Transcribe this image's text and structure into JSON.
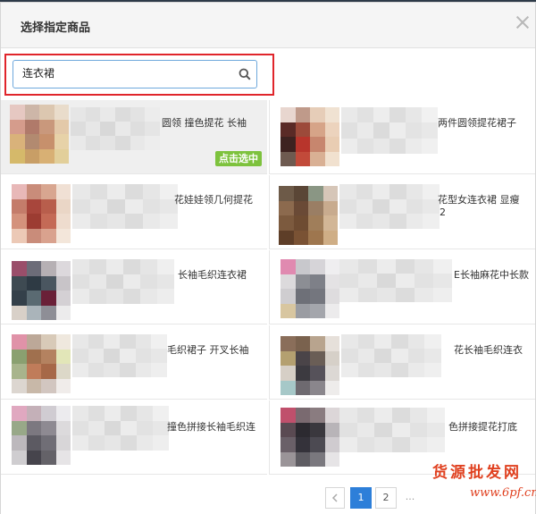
{
  "dialog": {
    "title": "选择指定商品",
    "close_icon": "close-icon"
  },
  "search": {
    "value": "连衣裙",
    "icon": "search-icon"
  },
  "products": [
    {
      "name": "圆领 撞色提花 长袖",
      "selected": true,
      "action_label": "点击选中"
    },
    {
      "name": "两件圆领提花裙子",
      "selected": false
    },
    {
      "name": "花娃娃领几何提花",
      "selected": false
    },
    {
      "name": "花型女连衣裙 显瘦",
      "name_line2": "2",
      "selected": false
    },
    {
      "name": "长袖毛织连衣裙",
      "selected": false
    },
    {
      "name": "E长袖麻花中长款",
      "selected": false
    },
    {
      "name": "毛织裙子 开叉长袖",
      "selected": false
    },
    {
      "name": "花长袖毛织连衣",
      "selected": false
    },
    {
      "name": "撞色拼接长袖毛织连",
      "selected": false
    },
    {
      "name": "色拼接提花打底",
      "selected": false
    }
  ],
  "pagination": {
    "prev_icon": "chevron-left-icon",
    "pages": [
      "1",
      "2"
    ],
    "active_page": "1",
    "ellipsis": "...",
    "next_icon": "chevron-right-icon"
  },
  "watermark": {
    "line1": "货源批发网",
    "line2": "www.6pf.cn"
  },
  "colors": {
    "highlight_frame": "#e0252b",
    "pick_button": "#7dc23d",
    "active_page": "#2d7fd9"
  }
}
